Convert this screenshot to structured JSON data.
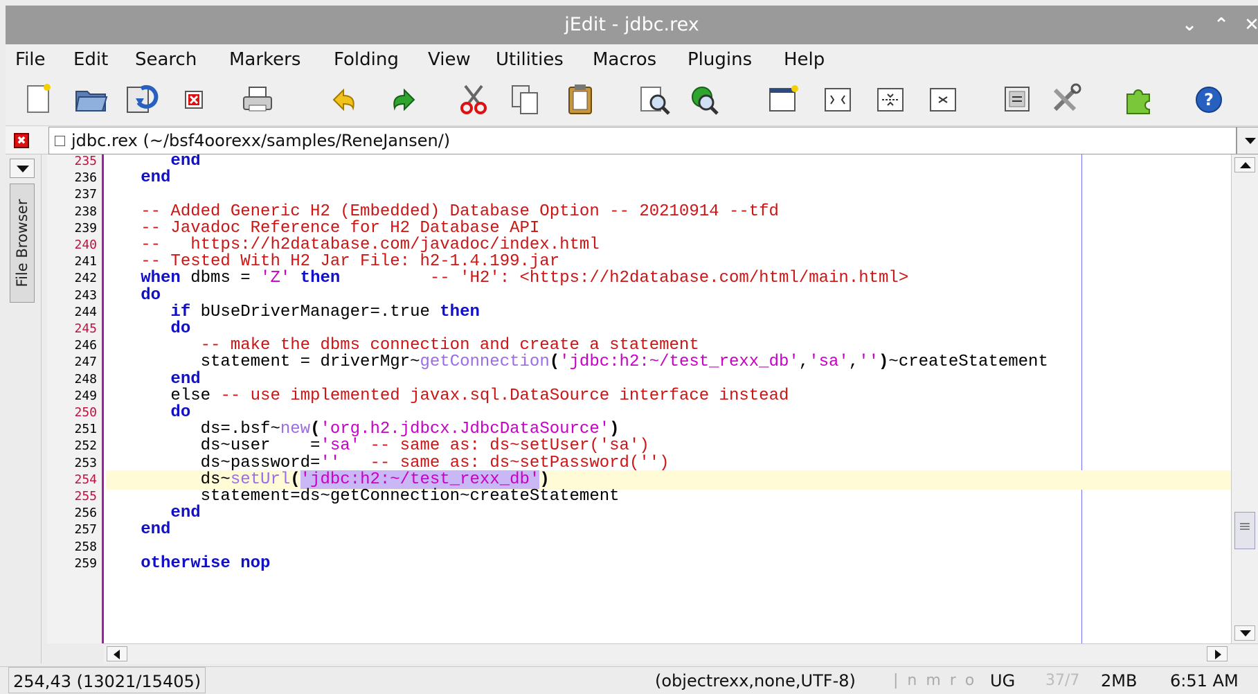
{
  "window": {
    "title": "jEdit - jdbc.rex",
    "minimize": "⌄",
    "maximize": "⌃",
    "close": "✕"
  },
  "menu": [
    "File",
    "Edit",
    "Search",
    "Markers",
    "Folding",
    "View",
    "Utilities",
    "Macros",
    "Plugins",
    "Help"
  ],
  "toolbar": [
    "new-file-icon",
    "open-file-icon",
    "reload-icon",
    "close-file-icon",
    "print-icon",
    "undo-icon",
    "redo-icon",
    "cut-icon",
    "copy-icon",
    "paste-icon",
    "find-icon",
    "find-in-files-icon",
    "new-view-icon",
    "split-horizontal-icon",
    "split-vertical-icon",
    "unsplit-icon",
    "buffer-options-icon",
    "global-options-icon",
    "plugin-manager-icon",
    "help-icon"
  ],
  "buffer": {
    "close_glyph": "✖",
    "label": "jdbc.rex (~/bsf4oorexx/samples/ReneJansen/)"
  },
  "dock": {
    "tab_label": "File Browser"
  },
  "editor": {
    "lines": [
      {
        "n": "235",
        "red": true,
        "segs": [
          [
            "kw",
            "      end"
          ]
        ]
      },
      {
        "n": "236",
        "red": false,
        "segs": [
          [
            "kw",
            "   end"
          ]
        ]
      },
      {
        "n": "237",
        "red": false,
        "segs": [
          [
            "",
            ""
          ]
        ]
      },
      {
        "n": "238",
        "red": false,
        "segs": [
          [
            "cm",
            "   -- Added Generic H2 (Embedded) Database Option -- 20210914 --tfd"
          ]
        ]
      },
      {
        "n": "239",
        "red": false,
        "segs": [
          [
            "cm",
            "   -- Javadoc Reference for H2 Database API"
          ]
        ]
      },
      {
        "n": "240",
        "red": true,
        "segs": [
          [
            "cm",
            "   --   https://h2database.com/javadoc/index.html"
          ]
        ]
      },
      {
        "n": "241",
        "red": false,
        "segs": [
          [
            "cm",
            "   -- Tested With H2 Jar File: h2-1.4.199.jar"
          ]
        ]
      },
      {
        "n": "242",
        "red": false,
        "segs": [
          [
            "kw",
            "   when"
          ],
          [
            "",
            " dbms = "
          ],
          [
            "st",
            "'Z'"
          ],
          [
            "",
            " "
          ],
          [
            "kw",
            "then"
          ],
          [
            "",
            "         "
          ],
          [
            "cm",
            "-- 'H2': <https://h2database.com/html/main.html>"
          ]
        ]
      },
      {
        "n": "243",
        "red": false,
        "segs": [
          [
            "kw",
            "   do"
          ]
        ]
      },
      {
        "n": "244",
        "red": false,
        "segs": [
          [
            "kw",
            "      if"
          ],
          [
            "",
            " bUseDriverManager=.true "
          ],
          [
            "kw",
            "then"
          ]
        ]
      },
      {
        "n": "245",
        "red": true,
        "segs": [
          [
            "kw",
            "      do"
          ]
        ]
      },
      {
        "n": "246",
        "red": false,
        "segs": [
          [
            "cm",
            "         -- make the dbms connection and create a statement"
          ]
        ]
      },
      {
        "n": "247",
        "red": false,
        "segs": [
          [
            "",
            "         statement = driverMgr~"
          ],
          [
            "fn",
            "getConnection"
          ],
          [
            "pu",
            "("
          ],
          [
            "st",
            "'jdbc:h2:~/test_rexx_db'"
          ],
          [
            "",
            ","
          ],
          [
            "st",
            "'sa'"
          ],
          [
            "",
            ","
          ],
          [
            "st",
            "''"
          ],
          [
            "pu",
            ")"
          ],
          [
            "",
            "~createStatement"
          ]
        ]
      },
      {
        "n": "248",
        "red": false,
        "segs": [
          [
            "kw",
            "      end"
          ]
        ]
      },
      {
        "n": "249",
        "red": false,
        "segs": [
          [
            "",
            "      else "
          ],
          [
            "cm",
            "-- use implemented javax.sql.DataSource interface instead"
          ]
        ]
      },
      {
        "n": "250",
        "red": true,
        "segs": [
          [
            "kw",
            "      do"
          ]
        ]
      },
      {
        "n": "251",
        "red": false,
        "segs": [
          [
            "",
            "         ds=.bsf~"
          ],
          [
            "fn",
            "new"
          ],
          [
            "pu",
            "("
          ],
          [
            "st",
            "'org.h2.jdbcx.JdbcDataSource'"
          ],
          [
            "pu",
            ")"
          ]
        ]
      },
      {
        "n": "252",
        "red": false,
        "segs": [
          [
            "",
            "         ds~user    ="
          ],
          [
            "st",
            "'sa'"
          ],
          [
            "",
            " "
          ],
          [
            "cm",
            "-- same as: ds~setUser('sa')"
          ]
        ]
      },
      {
        "n": "253",
        "red": false,
        "segs": [
          [
            "",
            "         ds~password="
          ],
          [
            "st",
            "''"
          ],
          [
            "",
            "   "
          ],
          [
            "cm",
            "-- same as: ds~setPassword('')"
          ]
        ]
      },
      {
        "n": "254",
        "red": true,
        "segs": [
          [
            "",
            "         ds~"
          ],
          [
            "fn",
            "setUrl"
          ],
          [
            "pu",
            "("
          ],
          [
            "st sel",
            "'jdbc:h2:~/test_rexx_db'"
          ],
          [
            "pu",
            ")"
          ]
        ]
      },
      {
        "n": "255",
        "red": true,
        "segs": [
          [
            "",
            "         statement=ds~getConnection~createStatement"
          ]
        ]
      },
      {
        "n": "256",
        "red": false,
        "segs": [
          [
            "kw",
            "      end"
          ]
        ]
      },
      {
        "n": "257",
        "red": false,
        "segs": [
          [
            "kw",
            "   end"
          ]
        ]
      },
      {
        "n": "258",
        "red": false,
        "segs": [
          [
            "",
            ""
          ]
        ]
      },
      {
        "n": "259",
        "red": false,
        "segs": [
          [
            "kw",
            "   otherwise nop"
          ]
        ]
      }
    ],
    "current_line_index": 19
  },
  "status": {
    "position": "254,43 (13021/15405)",
    "mode": "(objectrexx,none,UTF-8)",
    "flags": "| n m r o",
    "ug": "UG",
    "memory_used": "37/7",
    "memory_total": "2MB",
    "clock": "6:51 AM"
  },
  "colors": {
    "keyword": "#1010c8",
    "comment": "#cc1515",
    "string": "#c800c8",
    "function": "#9b6ce8",
    "current_line": "#fffbd6",
    "selection": "#c9b8f5",
    "gutter_border": "#a020a0"
  }
}
